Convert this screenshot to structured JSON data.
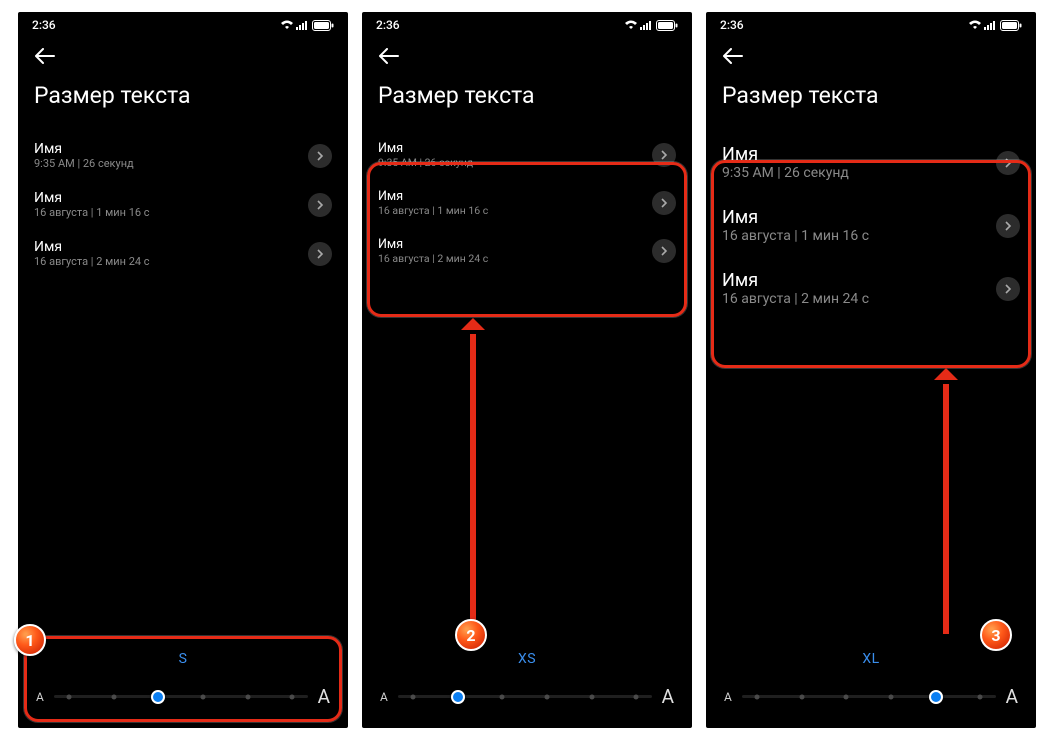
{
  "status": {
    "time": "2:36"
  },
  "header": {
    "title": "Размер текста"
  },
  "items": [
    {
      "name": "Имя",
      "sub": "9:35 AM | 26 секунд"
    },
    {
      "name": "Имя",
      "sub": "16 августа | 1 мин 16 с"
    },
    {
      "name": "Имя",
      "sub": "16 августа | 2 мин 24 с"
    }
  ],
  "slider": {
    "small_a": "A",
    "big_a": "A",
    "labels": {
      "s": "S",
      "xs": "XS",
      "xl": "XL"
    }
  },
  "badges": {
    "one": "1",
    "two": "2",
    "three": "3"
  }
}
